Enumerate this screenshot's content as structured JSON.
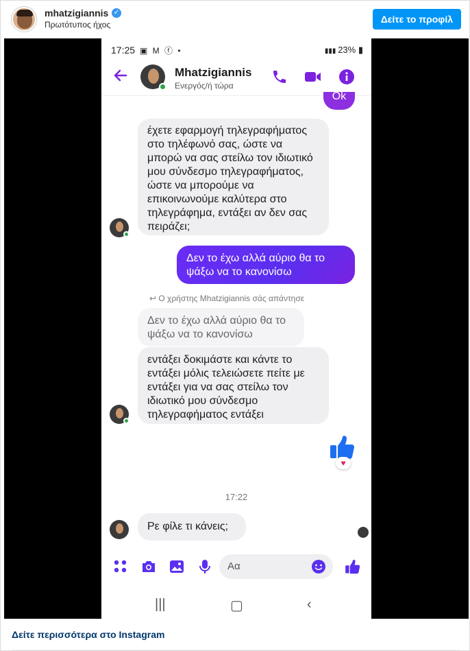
{
  "header": {
    "username": "mhatzigiannis",
    "subtitle": "Πρωτότυπος ήχος",
    "view_profile_label": "Δείτε το προφίλ",
    "verified_icon": "verified-badge"
  },
  "phone": {
    "status_bar": {
      "time": "17:25",
      "battery": "23%"
    },
    "chat_header": {
      "name": "Mhatzigiannis",
      "status": "Ενεργός/ή τώρα"
    },
    "messages": {
      "ok": "Ok",
      "in_1": "έχετε εφαρμογή τηλεγραφήματος στο τηλέφωνό σας, ώστε να μπορώ να σας στείλω τον ιδιωτικό μου σύνδεσμο τηλεγραφήματος, ώστε να μπορούμε να επικοινωνούμε καλύτερα στο τηλεγράφημα, εντάξει αν δεν σας πειράζει;",
      "out_1": "Δεν το έχω αλλά αύριο θα το ψάξω να το κανονίσω",
      "reply_note": "Ο χρήστης Mhatzigiannis σάς απάντησε",
      "quoted": "Δεν το έχω αλλά αύριο θα το ψάξω να το κανονίσω",
      "in_2": "εντάξει δοκιμάστε και κάντε το εντάξει μόλις τελειώσετε πείτε με εντάξει για να σας στείλω τον ιδιωτικό μου σύνδεσμο τηλεγραφήματος εντάξει",
      "timestamp": "17:22",
      "in_3": "Ρε φίλε τι κάνεις;"
    },
    "composer": {
      "placeholder": "Αα"
    }
  },
  "footer": {
    "more_link": "Δείτε περισσότερα στο Instagram"
  },
  "colors": {
    "accent": "#7a22e0",
    "button": "#0095f6",
    "online": "#31a24c"
  }
}
